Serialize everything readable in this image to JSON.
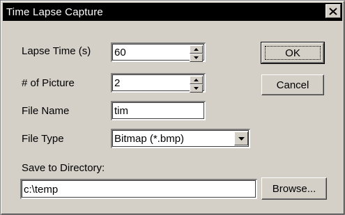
{
  "window": {
    "title": "Time Lapse Capture",
    "close_label": "×"
  },
  "form": {
    "lapse_time": {
      "label": "Lapse Time (s)",
      "value": "60"
    },
    "num_pictures": {
      "label": "# of Picture",
      "value": "2"
    },
    "file_name": {
      "label": "File Name",
      "value": "tim"
    },
    "file_type": {
      "label": "File Type",
      "value": "Bitmap (*.bmp)"
    },
    "save_dir": {
      "label": "Save to Directory:",
      "value": "c:\\temp"
    }
  },
  "buttons": {
    "ok": "OK",
    "cancel": "Cancel",
    "browse": "Browse..."
  },
  "icons": {
    "close": "close-icon",
    "spin_up": "triangle-up-icon",
    "spin_down": "triangle-down-icon",
    "dropdown": "triangle-down-icon"
  },
  "colors": {
    "titlebar": "#000000",
    "face": "#d4d0c8"
  }
}
